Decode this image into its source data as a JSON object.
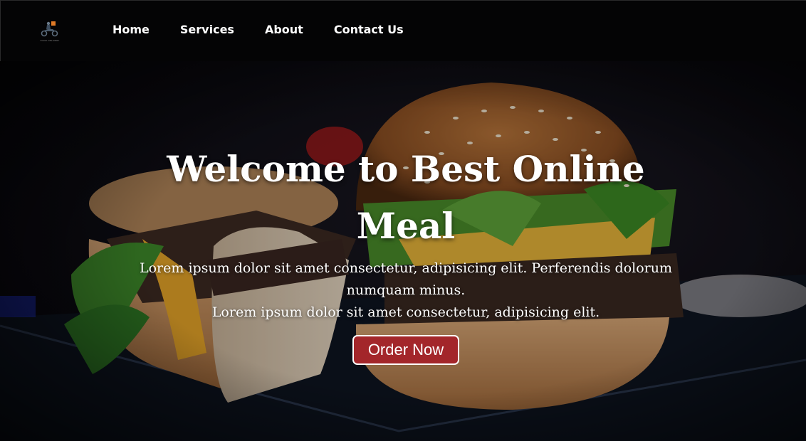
{
  "brand": {
    "logo_text": "FOOD DELIVERY"
  },
  "nav": {
    "items": [
      {
        "label": "Home"
      },
      {
        "label": "Services"
      },
      {
        "label": "About"
      },
      {
        "label": "Contact Us"
      }
    ]
  },
  "hero": {
    "title": "Welcome to Best Online Meal",
    "description_line1": "Lorem ipsum dolor sit amet consectetur, adipisicing elit. Perferendis dolorum numquam minus.",
    "description_line2": "Lorem ipsum dolor sit amet consectetur, adipisicing elit.",
    "cta_label": "Order Now",
    "background_image": "burger-photo"
  },
  "colors": {
    "navbar_bg": "#040405",
    "cta_bg": "#a3262a",
    "text": "#ffffff"
  }
}
